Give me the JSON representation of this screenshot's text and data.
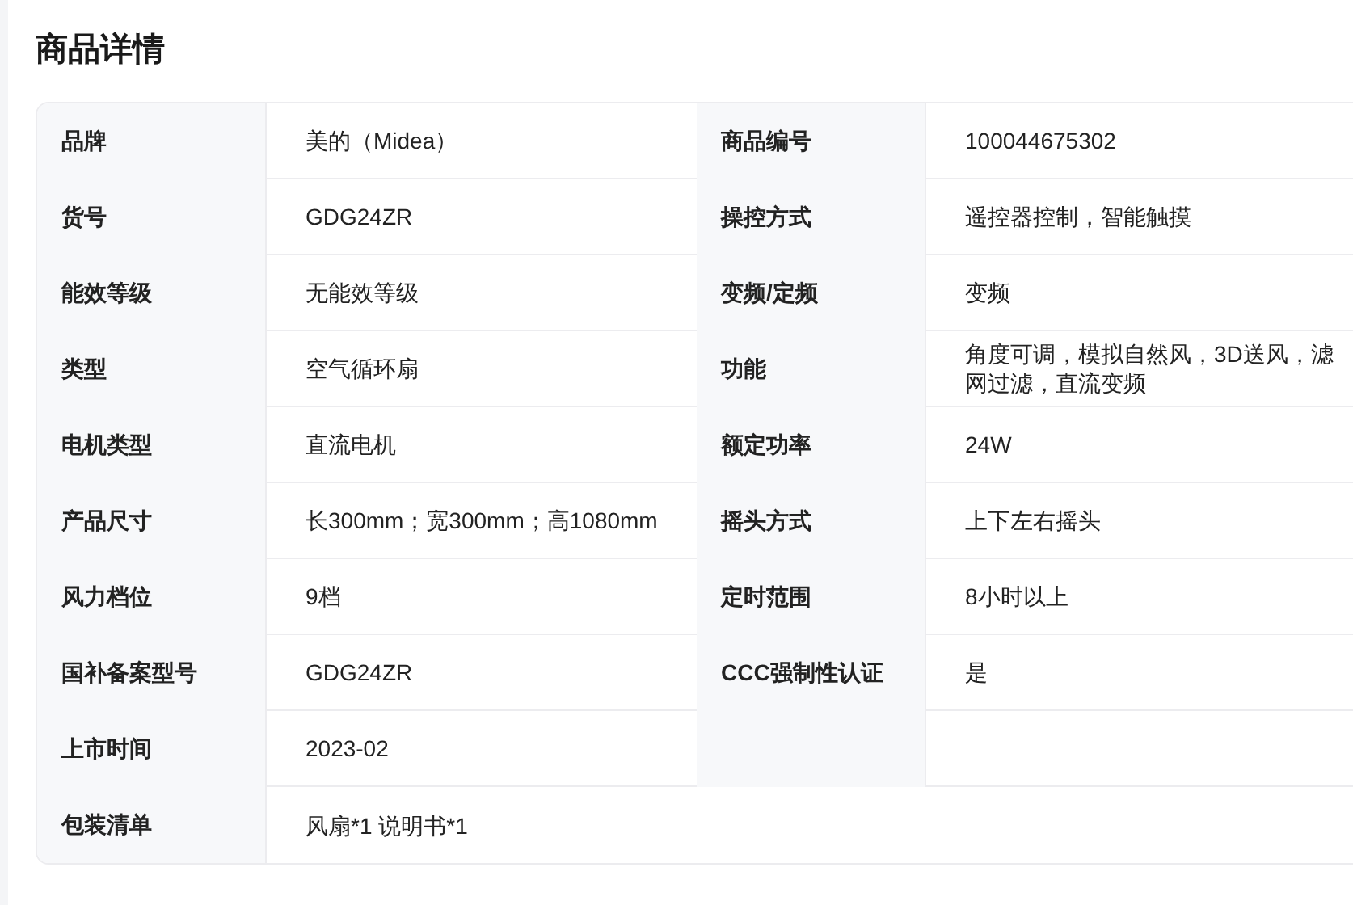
{
  "title": "商品详情",
  "rows": [
    {
      "kind": "pair",
      "items": [
        {
          "label": "品牌",
          "value": "美的（Midea）"
        },
        {
          "label": "商品编号",
          "value": "100044675302"
        }
      ]
    },
    {
      "kind": "pair",
      "items": [
        {
          "label": "货号",
          "value": "GDG24ZR"
        },
        {
          "label": "操控方式",
          "value": "遥控器控制，智能触摸"
        }
      ]
    },
    {
      "kind": "pair",
      "items": [
        {
          "label": "能效等级",
          "value": "无能效等级"
        },
        {
          "label": "变频/定频",
          "value": "变频"
        }
      ]
    },
    {
      "kind": "pair",
      "items": [
        {
          "label": "类型",
          "value": "空气循环扇"
        },
        {
          "label": "功能",
          "value": "角度可调，模拟自然风，3D送风，滤网过滤，直流变频"
        }
      ]
    },
    {
      "kind": "pair",
      "items": [
        {
          "label": "电机类型",
          "value": "直流电机"
        },
        {
          "label": "额定功率",
          "value": "24W"
        }
      ]
    },
    {
      "kind": "pair",
      "items": [
        {
          "label": "产品尺寸",
          "value": "长300mm；宽300mm；高1080mm"
        },
        {
          "label": "摇头方式",
          "value": "上下左右摇头"
        }
      ]
    },
    {
      "kind": "pair",
      "items": [
        {
          "label": "风力档位",
          "value": "9档"
        },
        {
          "label": "定时范围",
          "value": "8小时以上"
        }
      ]
    },
    {
      "kind": "pair",
      "items": [
        {
          "label": "国补备案型号",
          "value": "GDG24ZR"
        },
        {
          "label": "CCC强制性认证",
          "value": "是"
        }
      ]
    },
    {
      "kind": "pair",
      "items": [
        {
          "label": "上市时间",
          "value": "2023-02"
        }
      ]
    },
    {
      "kind": "wide",
      "items": [
        {
          "label": "包装清单",
          "value": "风扇*1 说明书*1"
        }
      ]
    }
  ]
}
